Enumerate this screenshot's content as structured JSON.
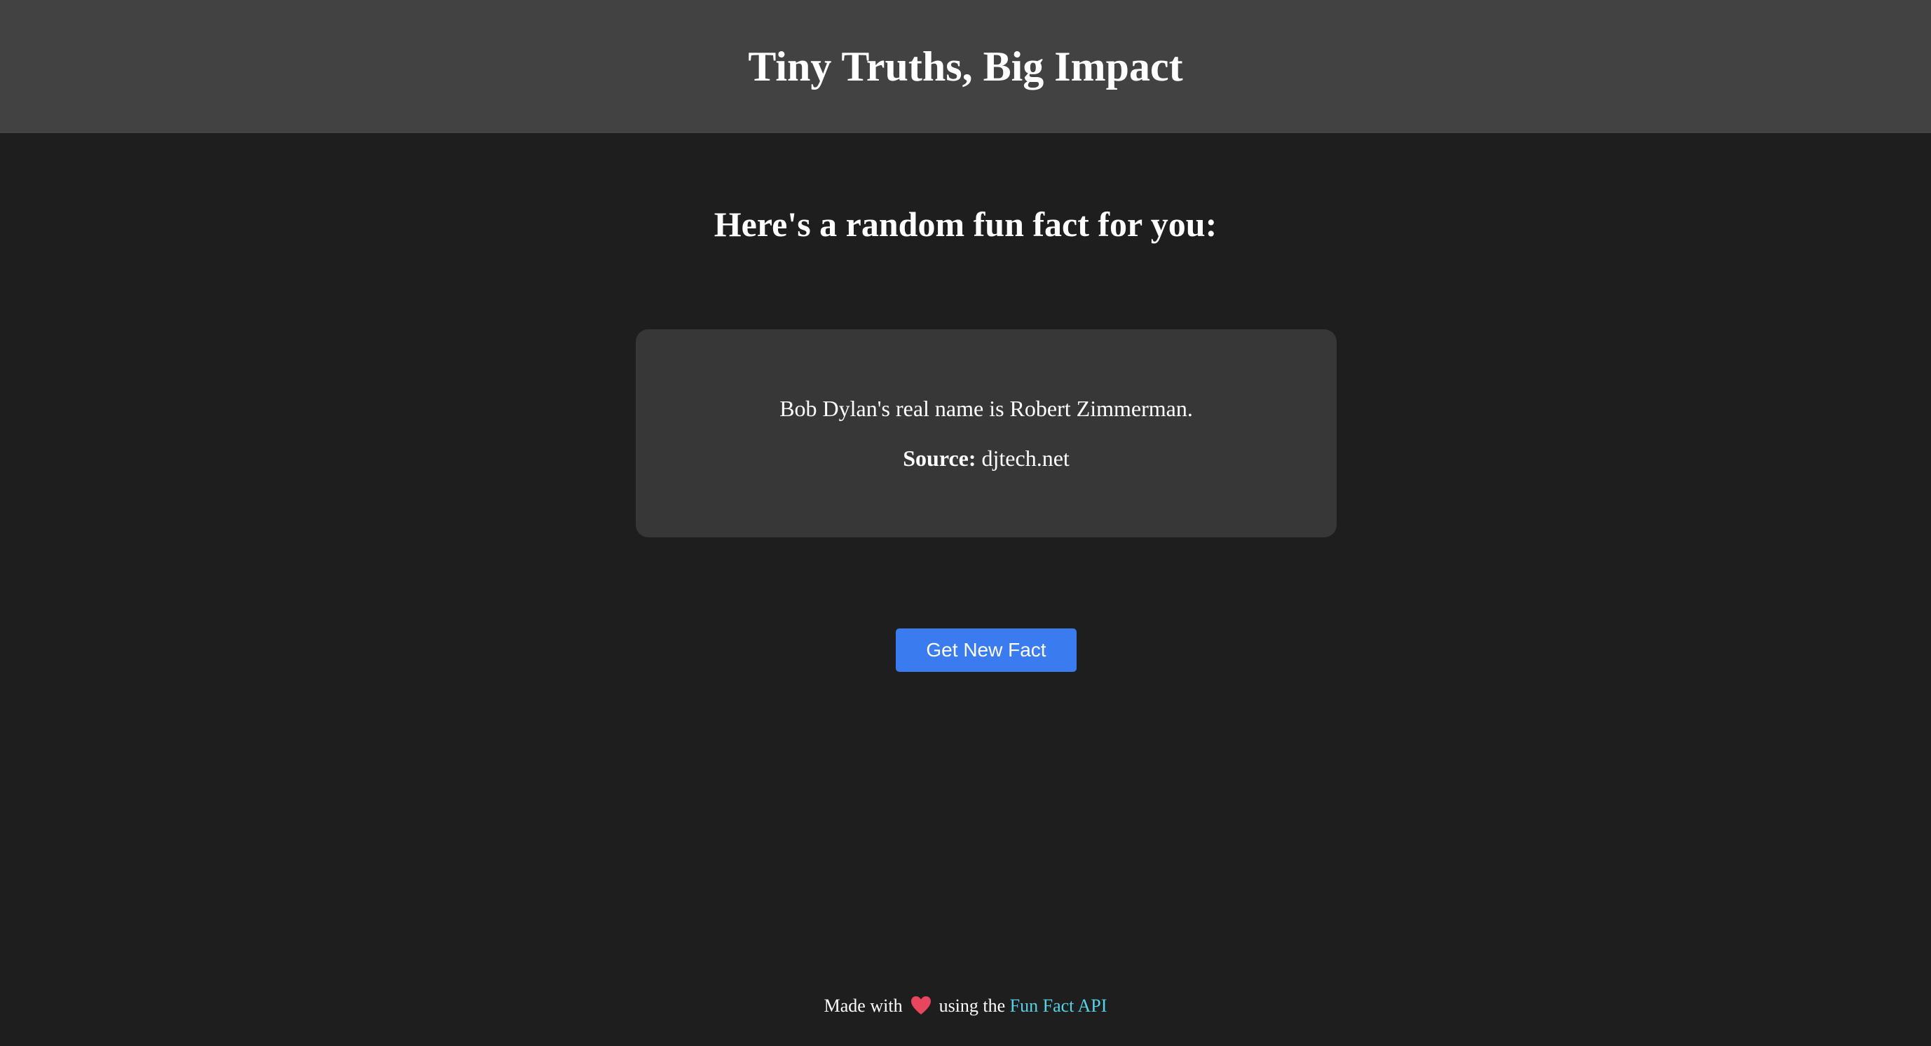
{
  "header": {
    "title": "Tiny Truths, Big Impact"
  },
  "main": {
    "heading": "Here's a random fun fact for you:",
    "fact": {
      "text": "Bob Dylan's real name is Robert Zimmerman.",
      "source_label": "Source:",
      "source_value": "djtech.net"
    },
    "button_label": "Get New Fact"
  },
  "footer": {
    "prefix": "Made with",
    "icon": "heart-icon",
    "middle": "using the",
    "link_text": "Fun Fact API"
  },
  "colors": {
    "header_bg": "#434242",
    "page_bg": "#1e1e1e",
    "card_bg": "#373737",
    "button_bg": "#3a7cf0",
    "link": "#56d3e8",
    "heart": "#e8455f"
  }
}
